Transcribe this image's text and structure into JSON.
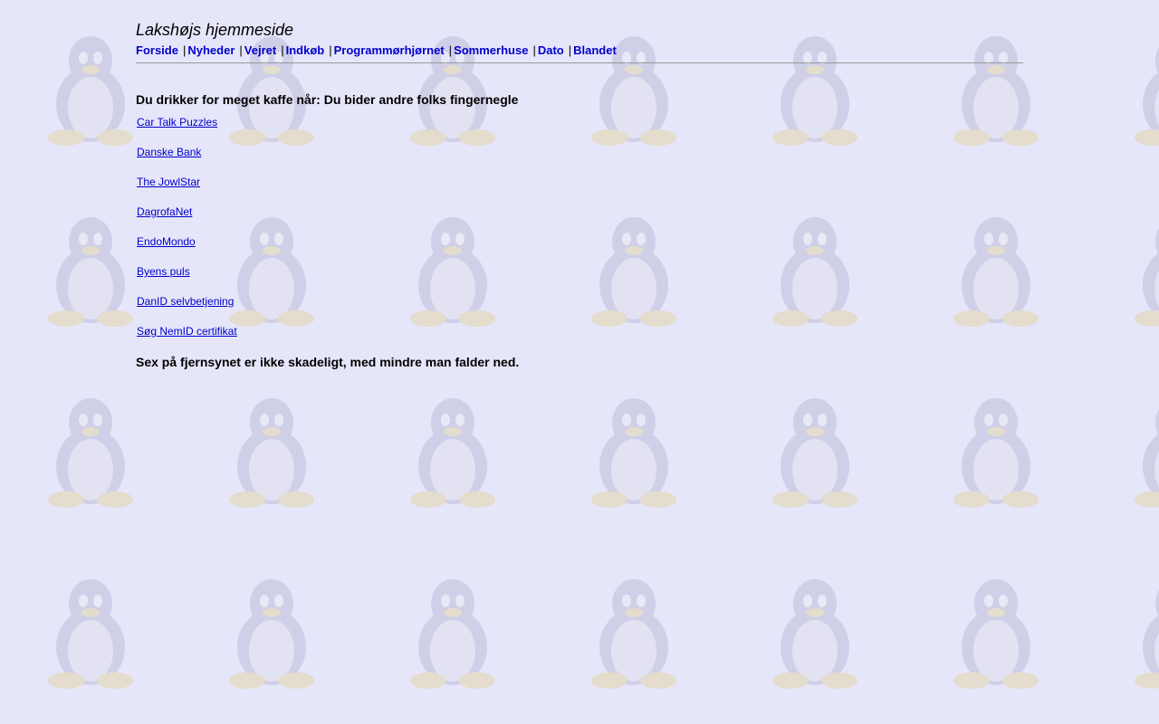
{
  "site": {
    "title": "Lakshøjs hjemmeside"
  },
  "nav": {
    "separator": "|",
    "items": [
      {
        "label": "Forside"
      },
      {
        "label": "Nyheder"
      },
      {
        "label": "Vejret"
      },
      {
        "label": "Indkøb"
      },
      {
        "label": "Programmørhjørnet"
      },
      {
        "label": "Sommerhuse"
      },
      {
        "label": "Dato"
      },
      {
        "label": "Blandet"
      }
    ]
  },
  "quotes": {
    "top": "Du drikker for meget kaffe når: Du bider andre folks fingernegle",
    "bottom": "Sex på fjernsynet er ikke skadeligt, med mindre man falder ned."
  },
  "links": [
    {
      "label": "Car Talk Puzzles"
    },
    {
      "label": "Danske Bank"
    },
    {
      "label": "The JowlStar"
    },
    {
      "label": "DagrofaNet"
    },
    {
      "label": "EndoMondo"
    },
    {
      "label": "Byens puls"
    },
    {
      "label": "DanID selvbetjening"
    },
    {
      "label": "Søg NemID certifikat"
    }
  ],
  "colors": {
    "background": "#e6e6fa",
    "link": "#0000cc",
    "rule": "#999999",
    "watermark_tux": "#c8c8e6"
  },
  "background_icon": "tux-penguin-icon"
}
